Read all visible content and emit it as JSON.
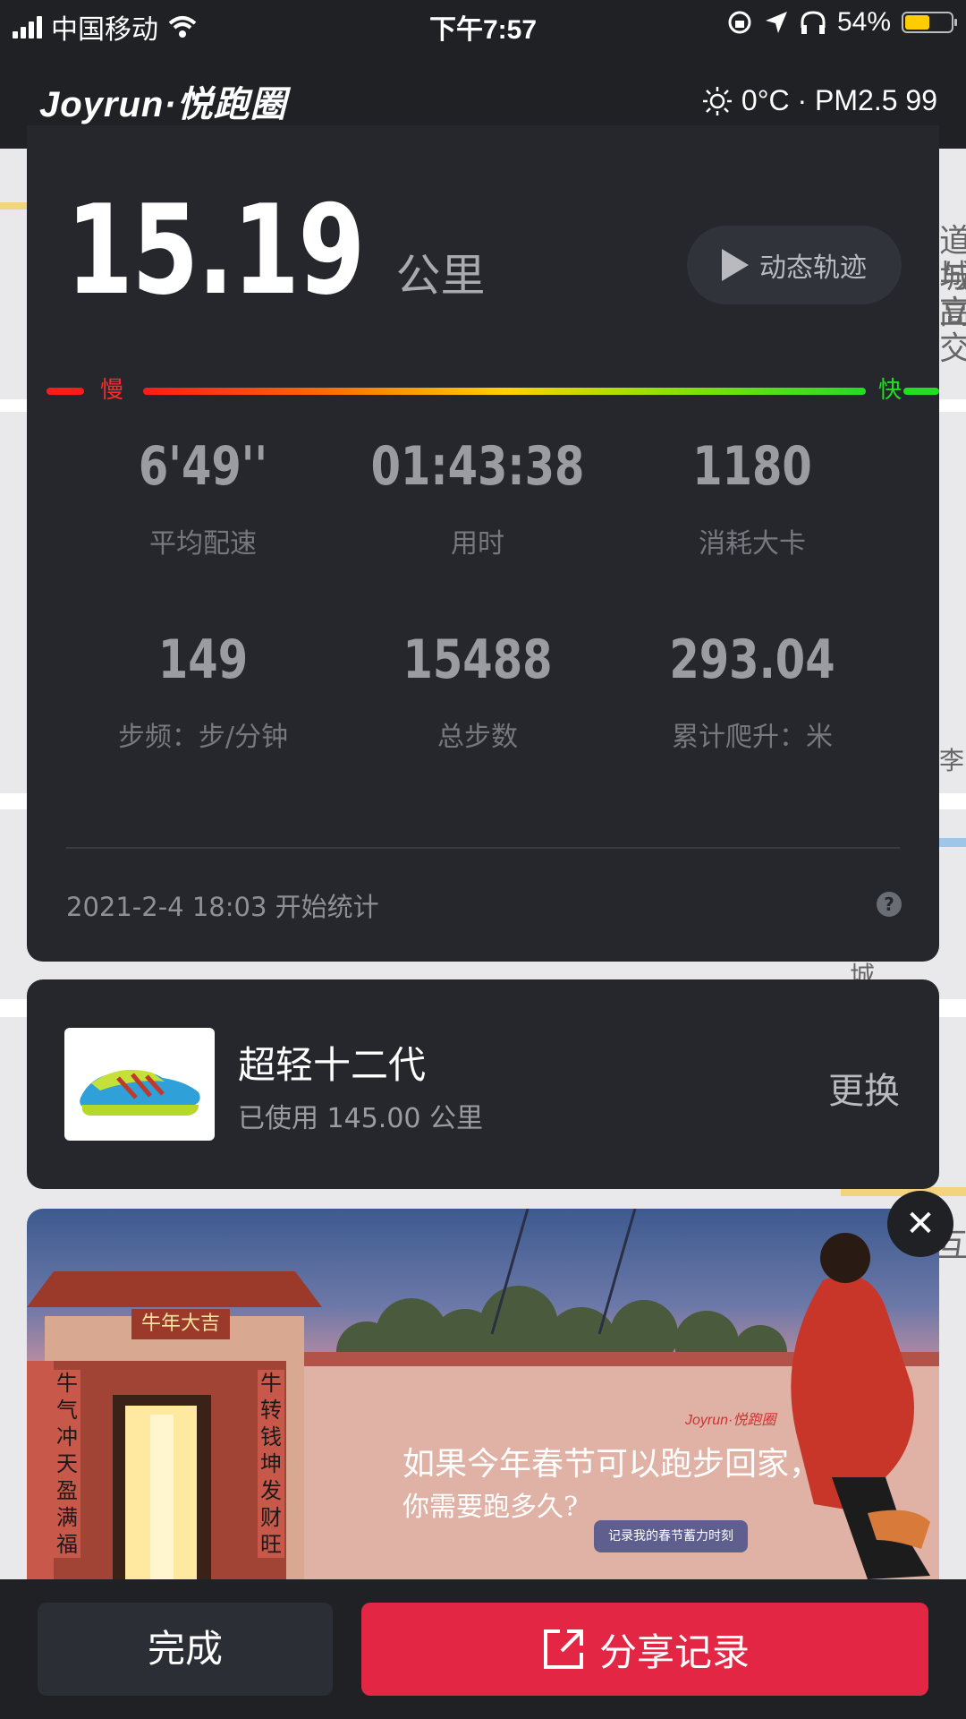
{
  "status_bar": {
    "carrier": "中国移动",
    "time": "下午7:57",
    "battery_percent": "54%",
    "battery_level": 0.54
  },
  "header": {
    "logo": "Joyrun·悦跑圈",
    "weather": "0°C · PM2.5 99"
  },
  "run": {
    "distance": "15.19",
    "distance_unit": "公里",
    "replay_label": "动态轨迹",
    "pace_slow_label": "慢",
    "pace_fast_label": "快",
    "stats": [
      {
        "value": "6'49''",
        "label": "平均配速"
      },
      {
        "value": "01:43:38",
        "label": "用时"
      },
      {
        "value": "1180",
        "label": "消耗大卡"
      },
      {
        "value": "149",
        "label": "步频：步/分钟"
      },
      {
        "value": "15488",
        "label": "总步数"
      },
      {
        "value": "293.04",
        "label": "累计爬升：米"
      }
    ],
    "started_at": "2021-2-4 18:03 开始统计",
    "help_glyph": "?"
  },
  "shoe": {
    "name": "超轻十二代",
    "used": "已使用 145.00 公里",
    "change_label": "更换"
  },
  "banner": {
    "brand": "Joyrun·悦跑圈",
    "headline": "如果今年春节可以跑步回家，",
    "subline": "你需要跑多久?",
    "cta": "记录我的春节蓄力时刻",
    "gate_plaque": "牛年大吉",
    "couplet_left": "牛气冲天盈满福",
    "couplet_right": "牛转钱坤发财旺",
    "close_glyph": "✕"
  },
  "map": {
    "labels": [
      "道与",
      "城高",
      "立交",
      "李",
      "城",
      "互"
    ]
  },
  "actions": {
    "done_label": "完成",
    "share_label": "分享记录"
  },
  "colors": {
    "accent_red": "#e32644",
    "pace_slow": "#ff1a1a",
    "pace_fast": "#22dd22"
  }
}
